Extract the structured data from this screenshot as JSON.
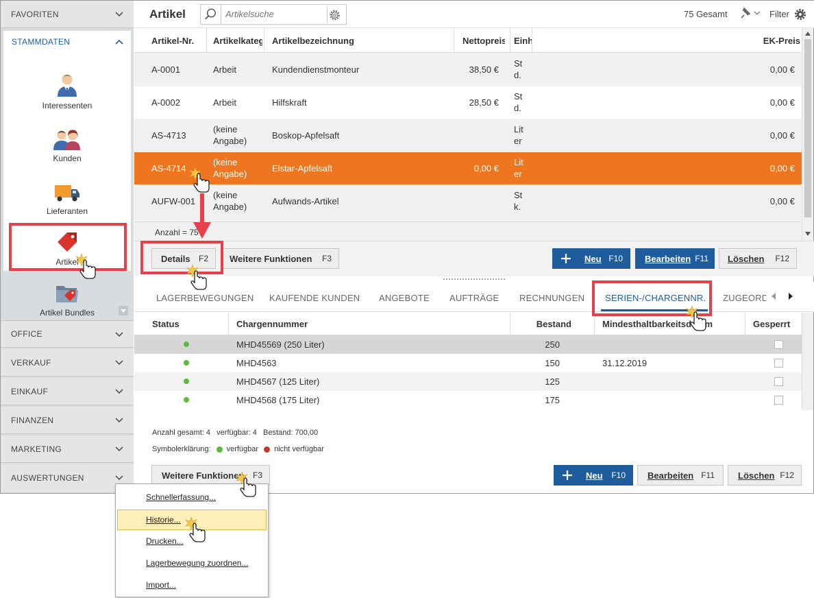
{
  "sidebar": {
    "sections_top": [
      {
        "label": "FAVORITEN"
      }
    ],
    "stammdaten": {
      "label": "STAMMDATEN",
      "modules": [
        {
          "label": "Interessenten",
          "icon": "person-icon"
        },
        {
          "label": "Kunden",
          "icon": "people-icon"
        },
        {
          "label": "Lieferanten",
          "icon": "truck-icon"
        },
        {
          "label": "Artikel",
          "icon": "tag-icon"
        },
        {
          "label": "Artikel Bundles",
          "icon": "folder-tag-icon"
        }
      ]
    },
    "sections_bottom": [
      {
        "label": "OFFICE"
      },
      {
        "label": "VERKAUF"
      },
      {
        "label": "EINKAUF"
      },
      {
        "label": "FINANZEN"
      },
      {
        "label": "MARKETING"
      },
      {
        "label": "AUSWERTUNGEN"
      }
    ]
  },
  "header": {
    "title": "Artikel",
    "search_placeholder": "Artikelsuche",
    "total": "75 Gesamt",
    "filter": "Filter"
  },
  "articles": {
    "columns": [
      "Artikel-Nr.",
      "Artikelkateg",
      "Artikelbezeichnung",
      "Nettopreis",
      "Einh",
      "EK-Preis"
    ],
    "rows": [
      {
        "nr": "A-0001",
        "kat1": "Arbeit",
        "kat2": "",
        "bez": "Kundendienstmonteur",
        "netto": "38,50 €",
        "einh1": "St",
        "einh2": "d.",
        "ek": "0,00 €"
      },
      {
        "nr": "A-0002",
        "kat1": "Arbeit",
        "kat2": "",
        "bez": "Hilfskraft",
        "netto": "28,50 €",
        "einh1": "St",
        "einh2": "d.",
        "ek": "0,00 €"
      },
      {
        "nr": "AS-4713",
        "kat1": "(keine",
        "kat2": "Angabe)",
        "bez": "Boskop-Apfelsaft",
        "netto": "",
        "einh1": "Lit",
        "einh2": "er",
        "ek": "0,00 €"
      },
      {
        "nr": "AS-4714",
        "kat1": "(keine",
        "kat2": "Angabe)",
        "bez": "Elstar-Apfelsaft",
        "netto": "0,00 €",
        "einh1": "Lit",
        "einh2": "er",
        "ek": "0,00 €"
      },
      {
        "nr": "AUFW-001",
        "kat1": "(keine",
        "kat2": "Angabe)",
        "bez": "Aufwands-Artikel",
        "netto": "",
        "einh1": "St",
        "einh2": "k.",
        "ek": "0,00 €"
      }
    ],
    "count": "Anzahl = 75"
  },
  "toolbar_upper": {
    "details": "Details",
    "details_key": "F2",
    "weitere": "Weitere Funktionen",
    "weitere_key": "F3",
    "neu": "Neu",
    "neu_key": "F10",
    "bearbeiten": "Bearbeiten",
    "bearbeiten_key": "F11",
    "loeschen": "Löschen",
    "loeschen_key": "F12"
  },
  "tabs": [
    "LAGERBEWEGUNGEN",
    "KAUFENDE KUNDEN",
    "ANGEBOTE",
    "AUFTRÄGE",
    "RECHNUNGEN",
    "SERIEN-/CHARGENNR.",
    "ZUGEORDI"
  ],
  "charges": {
    "columns": [
      "Status",
      "Chargennummer",
      "Bestand",
      "Mindesthaltbarkeitsdatum",
      "Gesperrt"
    ],
    "rows": [
      {
        "nr": "MHD45569 (250 Liter)",
        "bestand": "250",
        "mhd": ""
      },
      {
        "nr": "MHD4563",
        "bestand": "150",
        "mhd": "31.12.2019"
      },
      {
        "nr": "MHD4567 (125 Liter)",
        "bestand": "125",
        "mhd": ""
      },
      {
        "nr": "MHD4568 (175 Liter)",
        "bestand": "175",
        "mhd": ""
      }
    ],
    "summary": "Anzahl gesamt: 4   verfügbar: 4   Bestand: 700,00",
    "legend_label": "Symbolerklärung:",
    "legend_available": "verfügbar",
    "legend_unavailable": "nicht verfügbar",
    "colors": {
      "available": "#5dba3c",
      "unavailable": "#c0392b"
    }
  },
  "toolbar_lower": {
    "weitere": "Weitere Funktionen",
    "weitere_key": "F3",
    "neu": "Neu",
    "neu_key": "F10",
    "bearbeiten": "Bearbeiten",
    "bearbeiten_key": "F11",
    "loeschen": "Löschen",
    "loeschen_key": "F12"
  },
  "menu": {
    "items": [
      "Schnellerfassung...",
      "Historie...",
      "Drucken...",
      "Lagerbewegung zuordnen...",
      "Import..."
    ]
  },
  "colors": {
    "accent_blue": "#1e5c9e",
    "selection_orange": "#ee7620",
    "highlight_red": "#e8404a"
  }
}
